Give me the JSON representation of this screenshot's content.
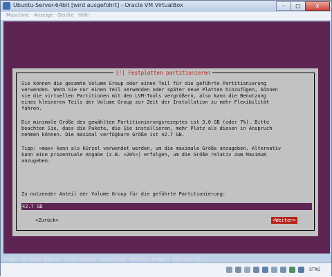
{
  "window": {
    "title": "Ubuntu-Server-64bit [wird ausgeführt] - Oracle VM VirtualBox",
    "buttons": {
      "minimize": "–",
      "maximize": "□",
      "close": "x"
    }
  },
  "menubar": {
    "items": [
      "Maschine",
      "Anzeige",
      "Geräte",
      "Hilfe"
    ]
  },
  "dialog": {
    "title": "[!] Festplatten partitionieren",
    "para1": [
      "Sie können die gesamte Volume Group oder einen Teil für die geführte Partitionierung",
      "verwenden. Wenn Sie nur einen Teil verwenden oder später neue Platten hinzufügen, können",
      "sie die virtuellen Partitionen mit den LVM-Tools vergrößern, also kann die Benutzung",
      "eines kleineren Teils der Volume Group zur Zeit der Installation zu mehr Flexibilität",
      "führen."
    ],
    "para2": [
      "Die minimale Größe des gewählten Partitionierungsrezeptes ist 3.0 GB (oder 7%). Bitte",
      "beachten Sie, dass die Pakete, die Sie installieren, mehr Platz als diesen in Anspruch",
      "nehmen können. Die maximal verfügbare Größe ist 42.7 GB."
    ],
    "para3": [
      "Tipp: »max« kann als Kürzel verwendet werden, um die maximale Größe anzugeben. Alternativ",
      "kann eine prozentuale Angabe (z.B. »20%«) erfolgen, um die Größe relativ zum Maximum",
      "anzugeben."
    ],
    "prompt": "Zu nutzender Anteil der Volume Group für die geführte Partitionierung:",
    "input_value": "42.7 GB",
    "back_label": "<Zurück>",
    "next_label": "<Weiter>"
  },
  "helpline": "<Tab> Nächste Option <Leertaste> Auswählen <Enter> Knöpfe aktivieren",
  "statusbar": {
    "host_key": "STRG"
  }
}
